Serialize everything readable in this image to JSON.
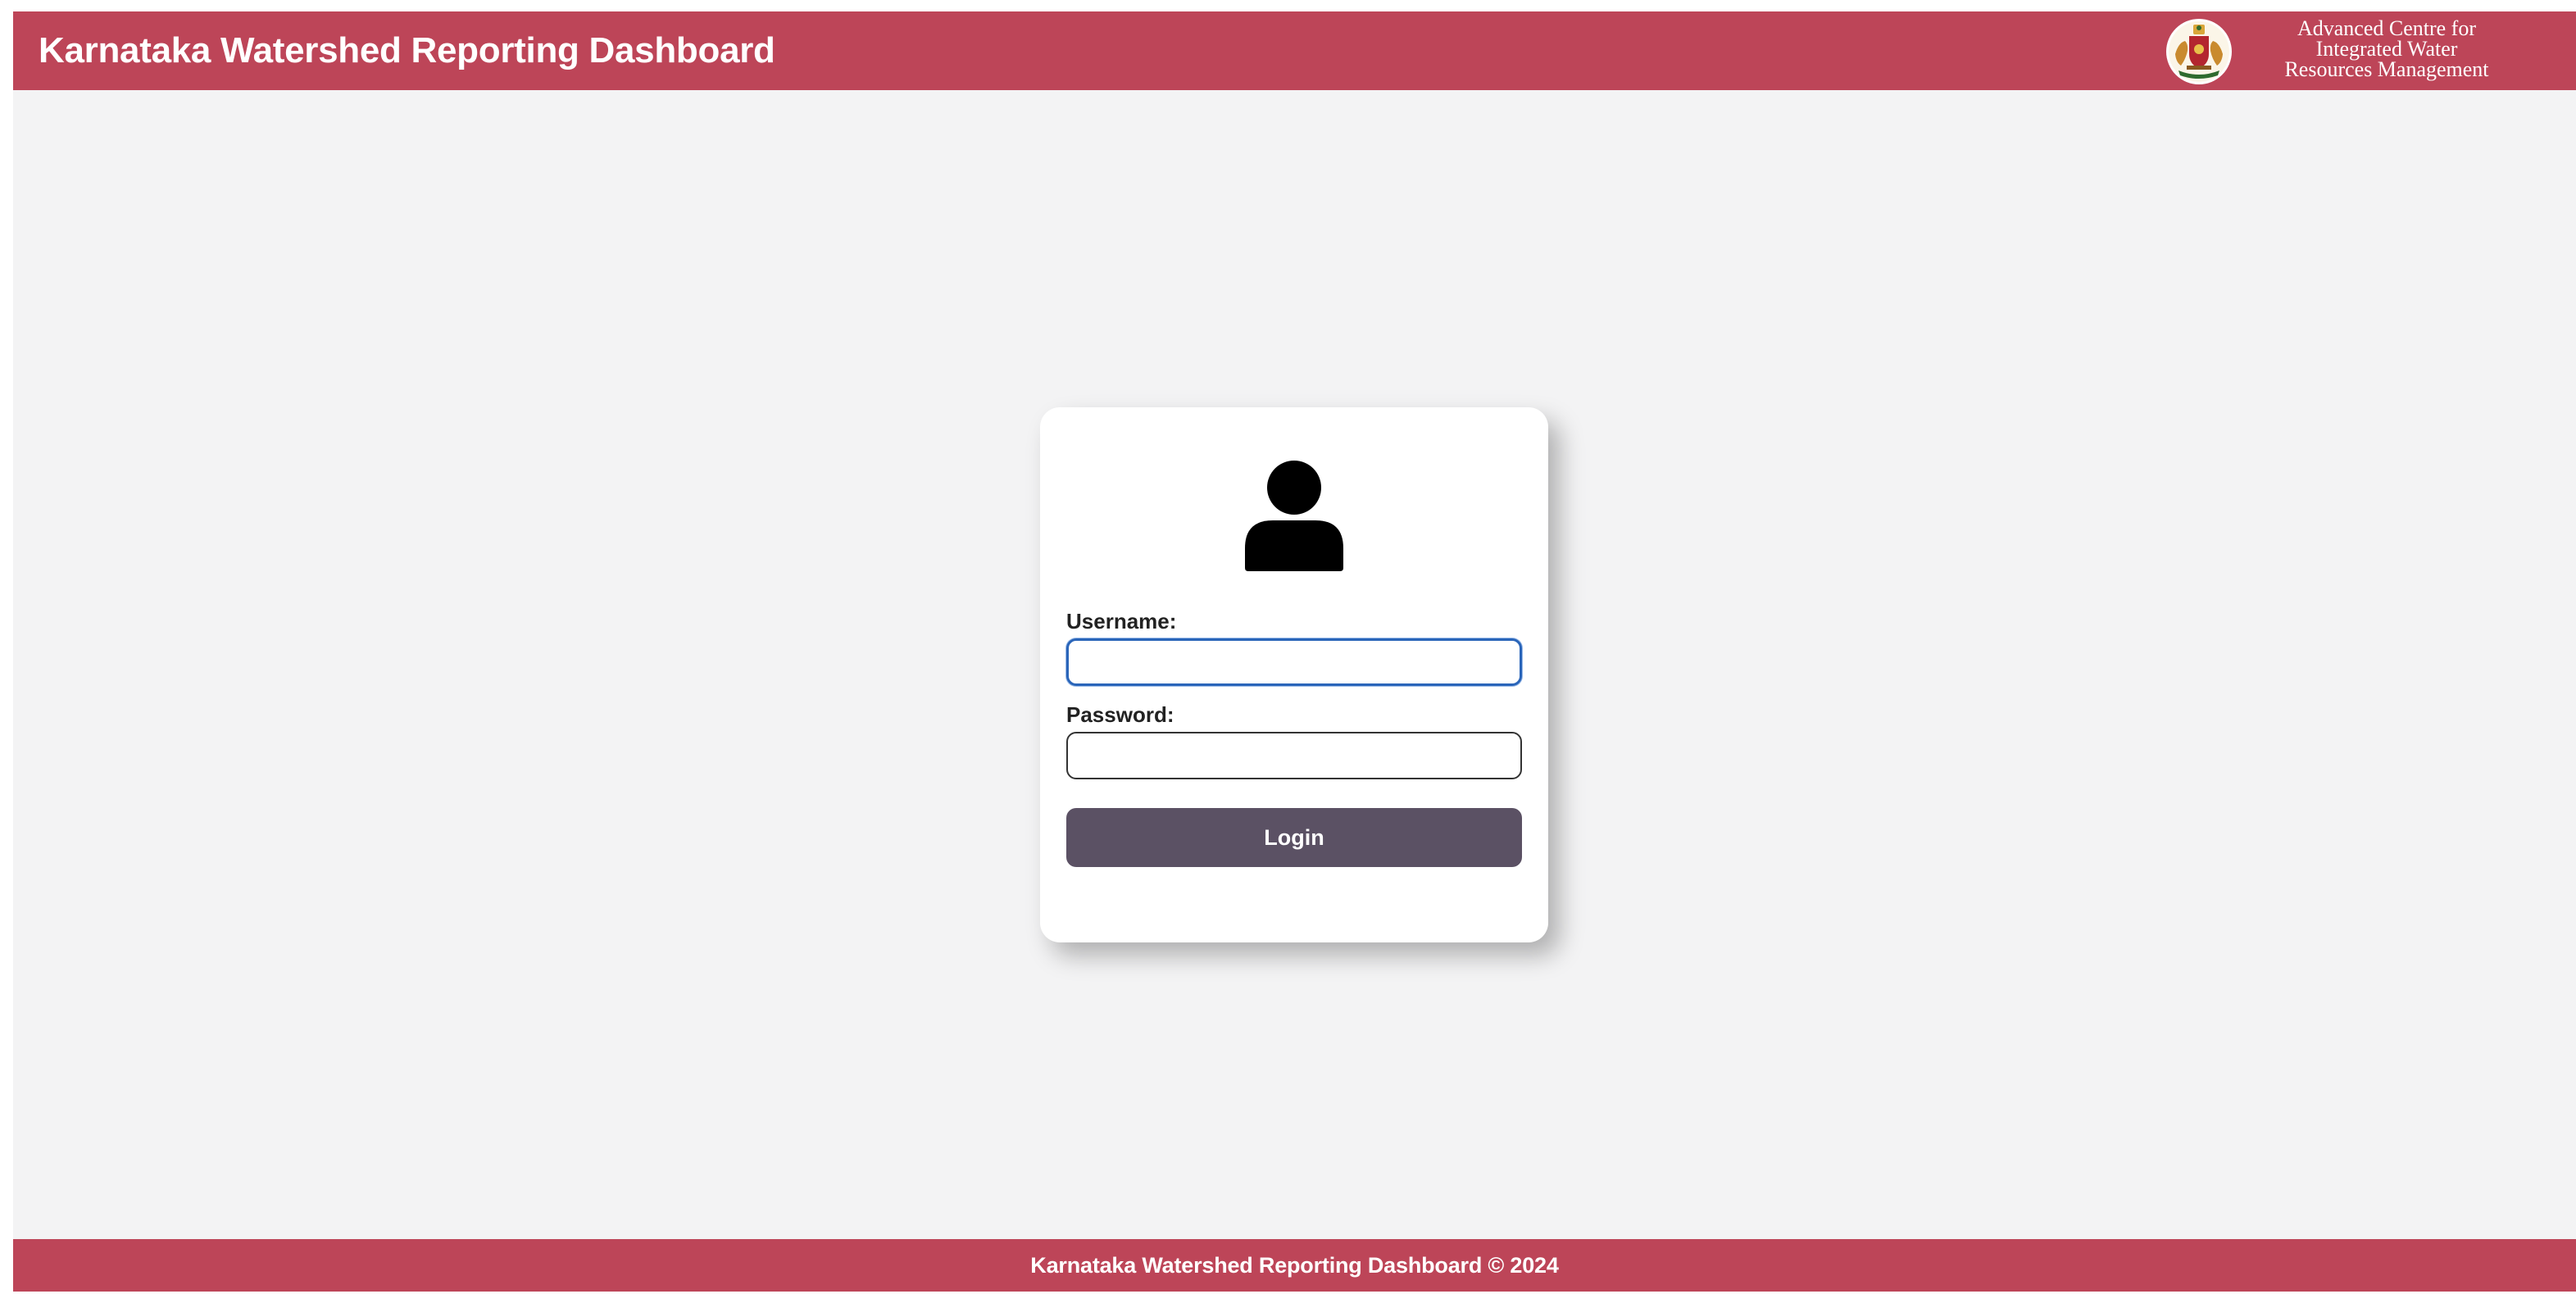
{
  "header": {
    "title": "Karnataka Watershed Reporting Dashboard",
    "org_name_lines": [
      "Advanced Centre for",
      "Integrated Water",
      "Resources Management"
    ],
    "emblem_icon": "karnataka-state-emblem-icon"
  },
  "login": {
    "avatar_icon": "user-icon",
    "username_label": "Username:",
    "username_value": "",
    "password_label": "Password:",
    "password_value": "",
    "login_label": "Login"
  },
  "footer": {
    "text": "Karnataka Watershed Reporting Dashboard © 2024"
  },
  "colors": {
    "brand": "#bd4558",
    "button": "#5b5164",
    "background": "#f3f3f4",
    "focus": "#2a65b9"
  }
}
